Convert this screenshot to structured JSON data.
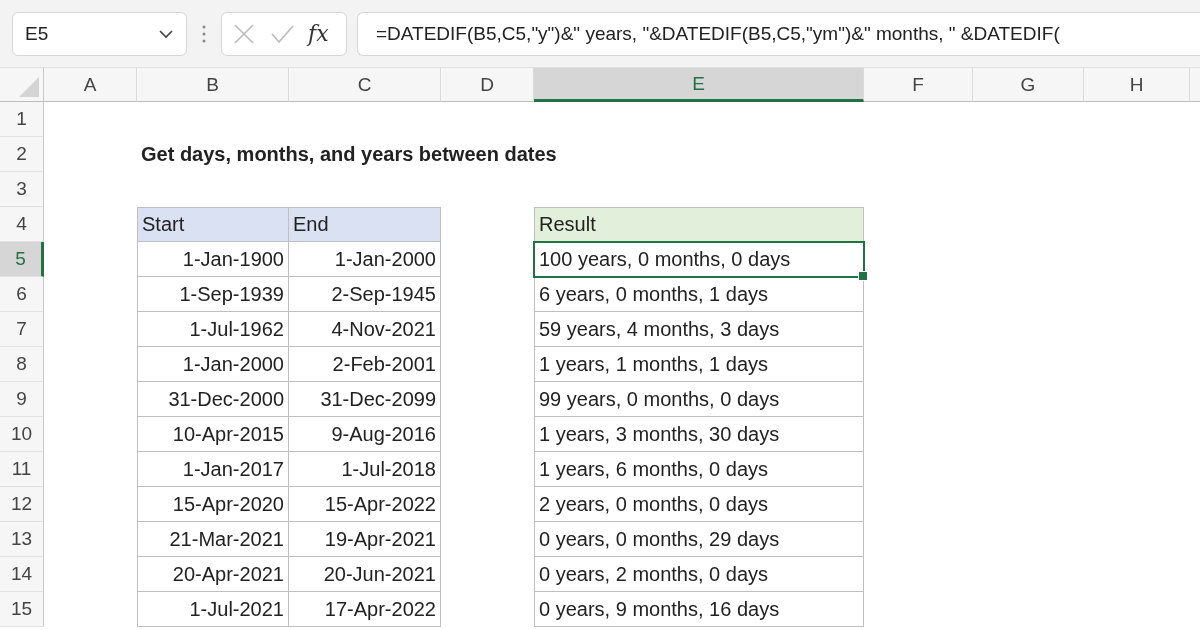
{
  "formula_bar": {
    "name_box": "E5",
    "function_label": "fx",
    "formula": "=DATEDIF(B5,C5,\"y\")&\" years, \"&DATEDIF(B5,C5,\"ym\")&\" months, \" &DATEDIF("
  },
  "columns": [
    {
      "label": "A",
      "selected": false
    },
    {
      "label": "B",
      "selected": false
    },
    {
      "label": "C",
      "selected": false
    },
    {
      "label": "D",
      "selected": false
    },
    {
      "label": "E",
      "selected": true
    },
    {
      "label": "F",
      "selected": false
    },
    {
      "label": "G",
      "selected": false
    },
    {
      "label": "H",
      "selected": false
    }
  ],
  "row_numbers": [
    {
      "label": "1",
      "selected": false
    },
    {
      "label": "2",
      "selected": false
    },
    {
      "label": "3",
      "selected": false
    },
    {
      "label": "4",
      "selected": false
    },
    {
      "label": "5",
      "selected": true
    },
    {
      "label": "6",
      "selected": false
    },
    {
      "label": "7",
      "selected": false
    },
    {
      "label": "8",
      "selected": false
    },
    {
      "label": "9",
      "selected": false
    },
    {
      "label": "10",
      "selected": false
    },
    {
      "label": "11",
      "selected": false
    },
    {
      "label": "12",
      "selected": false
    },
    {
      "label": "13",
      "selected": false
    },
    {
      "label": "14",
      "selected": false
    },
    {
      "label": "15",
      "selected": false
    }
  ],
  "title": "Get days, months, and years between dates",
  "dates_table": {
    "headers": [
      "Start",
      "End"
    ],
    "rows": [
      [
        "1-Jan-1900",
        "1-Jan-2000"
      ],
      [
        "1-Sep-1939",
        "2-Sep-1945"
      ],
      [
        "1-Jul-1962",
        "4-Nov-2021"
      ],
      [
        "1-Jan-2000",
        "2-Feb-2001"
      ],
      [
        "31-Dec-2000",
        "31-Dec-2099"
      ],
      [
        "10-Apr-2015",
        "9-Aug-2016"
      ],
      [
        "1-Jan-2017",
        "1-Jul-2018"
      ],
      [
        "15-Apr-2020",
        "15-Apr-2022"
      ],
      [
        "21-Mar-2021",
        "19-Apr-2021"
      ],
      [
        "20-Apr-2021",
        "20-Jun-2021"
      ],
      [
        "1-Jul-2021",
        "17-Apr-2022"
      ]
    ]
  },
  "result_table": {
    "header": "Result",
    "rows": [
      {
        "text": "100 years, 0 months, 0 days",
        "selected": true
      },
      {
        "text": "6 years, 0 months, 1 days",
        "selected": false
      },
      {
        "text": "59 years, 4 months, 3 days",
        "selected": false
      },
      {
        "text": "1 years, 1 months, 1 days",
        "selected": false
      },
      {
        "text": "99 years, 0 months, 0 days",
        "selected": false
      },
      {
        "text": "1 years, 3 months, 30 days",
        "selected": false
      },
      {
        "text": "1 years, 6 months, 0 days",
        "selected": false
      },
      {
        "text": "2 years, 0 months, 0 days",
        "selected": false
      },
      {
        "text": "0 years, 0 months, 29 days",
        "selected": false
      },
      {
        "text": "0 years, 2 months, 0 days",
        "selected": false
      },
      {
        "text": "0 years, 9 months, 16 days",
        "selected": false
      }
    ]
  }
}
